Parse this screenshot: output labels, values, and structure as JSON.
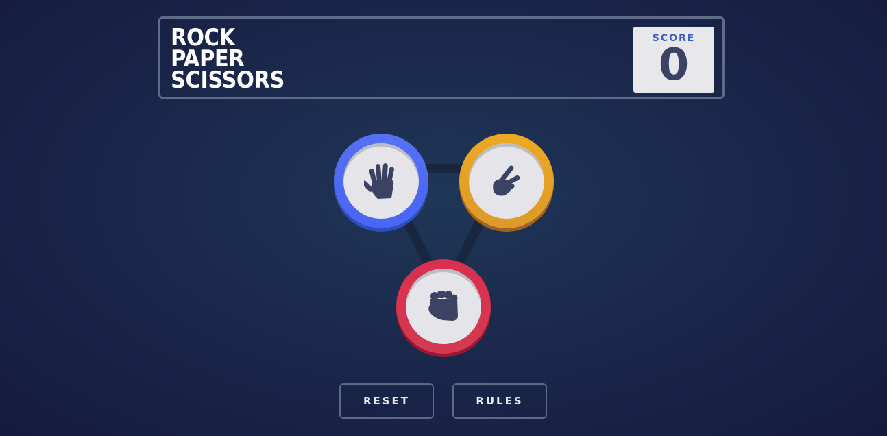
{
  "header": {
    "title_lines": [
      "ROCK",
      "PAPER",
      "SCISSORS"
    ],
    "score": {
      "label": "SCORE",
      "value": "0"
    }
  },
  "choices": [
    {
      "id": "paper",
      "icon": "paper-hand-icon",
      "ring_color": "#5671f5"
    },
    {
      "id": "scissors",
      "icon": "scissors-hand-icon",
      "ring_color": "#eca922"
    },
    {
      "id": "rock",
      "icon": "rock-fist-icon",
      "ring_color": "#dc2e4e"
    }
  ],
  "buttons": {
    "reset_label": "RESET",
    "rules_label": "RULES"
  },
  "colors": {
    "background": "#1f3756",
    "paper": "#5671f5",
    "scissors": "#eca922",
    "rock": "#dc2e4e",
    "icon": "#3b4263",
    "score_label": "#3b5bc5"
  }
}
